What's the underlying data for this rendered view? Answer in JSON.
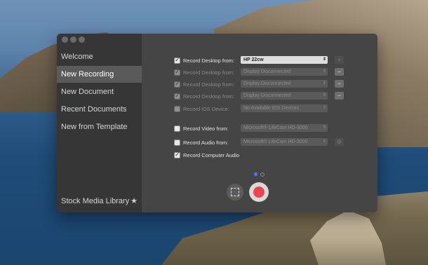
{
  "sidebar": {
    "items": [
      {
        "label": "Welcome"
      },
      {
        "label": "New Recording"
      },
      {
        "label": "New Document"
      },
      {
        "label": "Recent Documents"
      },
      {
        "label": "New from Template"
      }
    ],
    "footer_label": "Stock Media Library",
    "footer_icon": "star-icon"
  },
  "recording": {
    "rows": [
      {
        "label": "Record Desktop from:",
        "value": "HP 22cw",
        "checked": true,
        "enabled": true,
        "button": "+"
      },
      {
        "label": "Record Desktop from:",
        "value": "Display Disconnected",
        "checked": true,
        "enabled": false,
        "button": "−"
      },
      {
        "label": "Record Desktop from:",
        "value": "Display Disconnected",
        "checked": true,
        "enabled": false,
        "button": "−"
      },
      {
        "label": "Record Desktop from:",
        "value": "Display Disconnected",
        "checked": true,
        "enabled": false,
        "button": "−"
      },
      {
        "label": "Record iOS Device:",
        "value": "No Available iOS Devices",
        "checked": false,
        "enabled": false,
        "button": ""
      },
      {
        "label": "Record Video from:",
        "value": "Microsoft® LifeCam HD-3000",
        "checked": false,
        "enabled": true,
        "button": ""
      },
      {
        "label": "Record Audio from:",
        "value": "Microsoft® LifeCam HD-3000",
        "checked": false,
        "enabled": true,
        "button": "⚙"
      },
      {
        "label": "Record Computer Audio",
        "value": "",
        "checked": true,
        "enabled": true,
        "button": ""
      }
    ]
  },
  "pager": {
    "current": 1,
    "total": 2
  },
  "colors": {
    "record_red": "#e9474d",
    "page_dot_active": "#2f86ff"
  }
}
